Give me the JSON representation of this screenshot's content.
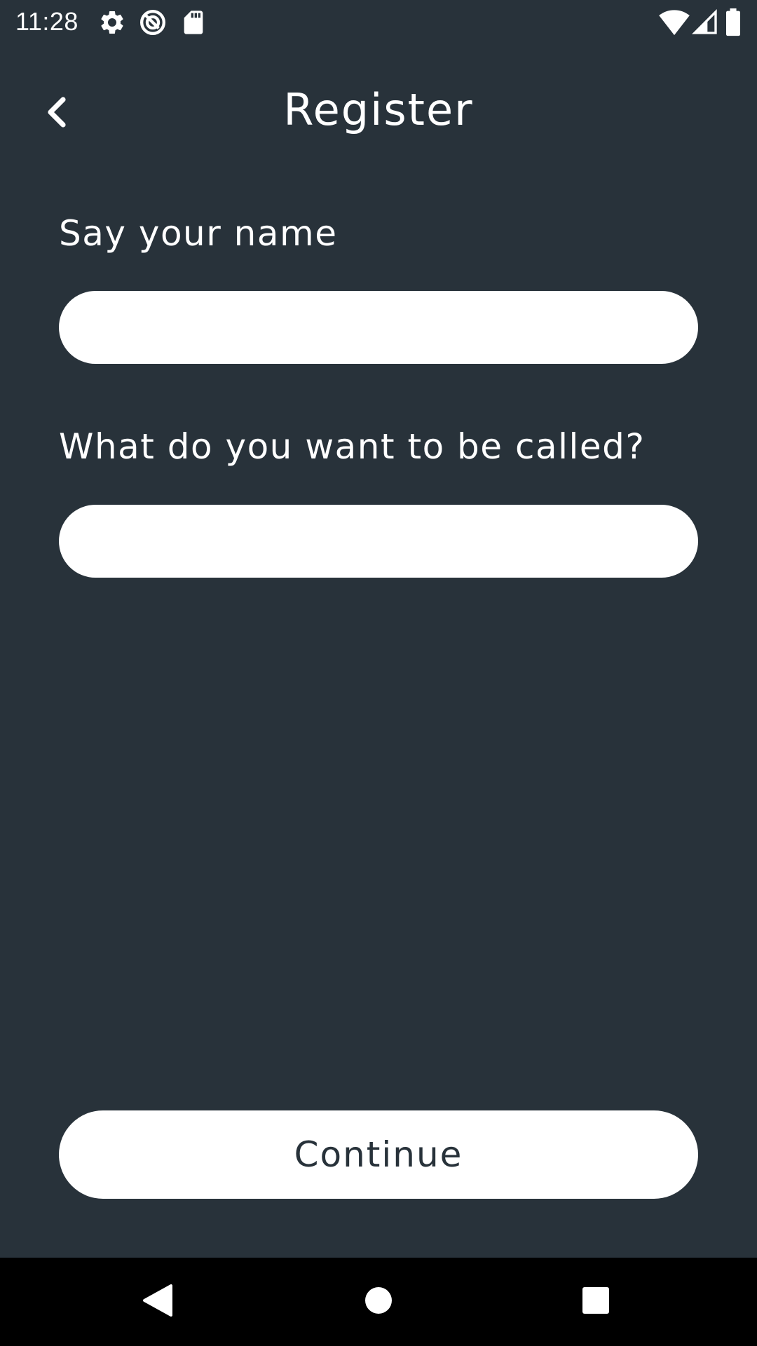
{
  "status_bar": {
    "time": "11:28",
    "icons": [
      "settings-icon",
      "sync-icon",
      "sd-card-icon",
      "wifi-icon",
      "signal-icon",
      "battery-icon"
    ]
  },
  "app_bar": {
    "title": "Register",
    "back_icon": "chevron-left-icon"
  },
  "form": {
    "name_label": "Say your name",
    "name_value": "",
    "nickname_label": "What do you want to be called?",
    "nickname_value": ""
  },
  "actions": {
    "continue_label": "Continue"
  },
  "nav_bar": {
    "icons": [
      "back-triangle-icon",
      "home-circle-icon",
      "recents-square-icon"
    ]
  },
  "colors": {
    "background": "#28323a",
    "surface": "#ffffff",
    "nav_background": "#000000"
  }
}
